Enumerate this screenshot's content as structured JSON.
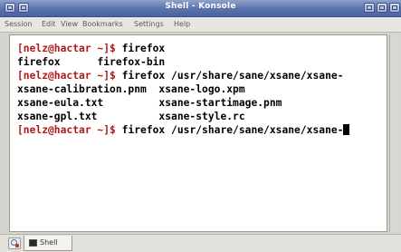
{
  "window": {
    "title": "Shell - Konsole",
    "title_bar_color": "#5d75ad"
  },
  "menu": {
    "items": [
      {
        "label": "Session"
      },
      {
        "label": "Edit"
      },
      {
        "label": "View"
      },
      {
        "label": "Bookmarks"
      },
      {
        "label": "Settings"
      },
      {
        "label": "Help"
      }
    ]
  },
  "terminal": {
    "prompt_color": "#b0181a",
    "lines": [
      {
        "prompt": "[nelz@hactar ~]$ ",
        "text": "firefox"
      },
      {
        "prompt": "",
        "text": "firefox      firefox-bin"
      },
      {
        "prompt": "[nelz@hactar ~]$ ",
        "text": "firefox /usr/share/sane/xsane/xsane-"
      },
      {
        "prompt": "",
        "text": "xsane-calibration.pnm  xsane-logo.xpm"
      },
      {
        "prompt": "",
        "text": "xsane-eula.txt         xsane-startimage.pnm"
      },
      {
        "prompt": "",
        "text": "xsane-gpl.txt          xsane-style.rc"
      },
      {
        "prompt": "[nelz@hactar ~]$ ",
        "text": "firefox /usr/share/sane/xsane/xsane-"
      }
    ]
  },
  "tabs": {
    "new_tab_icon": "new-session-icon",
    "items": [
      {
        "label": "Shell",
        "icon": "terminal-icon"
      }
    ]
  }
}
